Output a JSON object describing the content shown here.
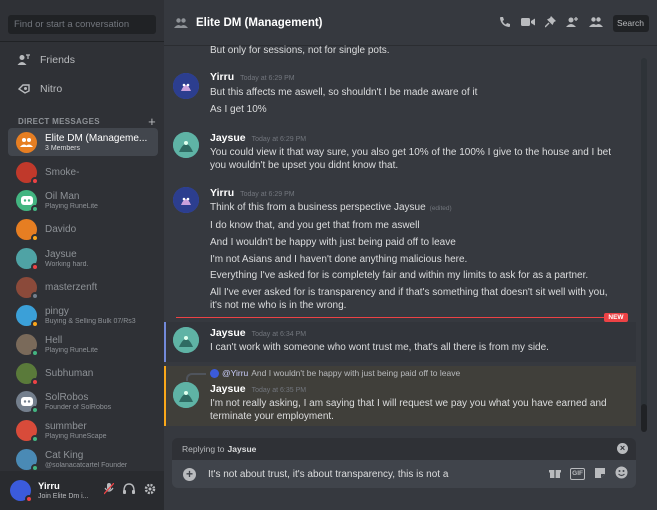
{
  "sidebar": {
    "search_placeholder": "Find or start a conversation",
    "nav": [
      {
        "label": "Friends"
      },
      {
        "label": "Nitro"
      }
    ],
    "dm_header": "DIRECT MESSAGES",
    "dms": [
      {
        "name": "Elite DM (Manageme...",
        "sub": "3 Members",
        "color": "#e67e22",
        "status": ""
      },
      {
        "name": "Smoke-",
        "sub": "",
        "color": "#c0392b",
        "status": "#ed4245"
      },
      {
        "name": "Oil Man",
        "sub": "Playing RuneLite",
        "color": "#43b581",
        "status": "#43b581"
      },
      {
        "name": "Davido",
        "sub": "",
        "color": "#e67e22",
        "status": "#faa61a"
      },
      {
        "name": "Jaysue",
        "sub": "Working hard.",
        "color": "#4fa3a5",
        "status": "#ed4245"
      },
      {
        "name": "masterzenft",
        "sub": "",
        "color": "#8b4a3a",
        "status": "#747f8d"
      },
      {
        "name": "pingy",
        "sub": "Buying & Selling Bulk 07/Rs3",
        "color": "#3ba0d8",
        "status": "#faa61a"
      },
      {
        "name": "Hell",
        "sub": "Playing RuneLite",
        "color": "#7a6a5a",
        "status": "#43b581"
      },
      {
        "name": "Subhuman",
        "sub": "",
        "color": "#5a7a3a",
        "status": "#ed4245"
      },
      {
        "name": "SolRobos",
        "sub": "Founder of SolRobos",
        "color": "#747f8d",
        "status": "#43b581"
      },
      {
        "name": "summber",
        "sub": "Playing RuneScape",
        "color": "#d84b3a",
        "status": "#43b581"
      },
      {
        "name": "Cat King",
        "sub": "@solanacatcartel Founder",
        "color": "#4a8ab5",
        "status": "#43b581"
      }
    ],
    "user": {
      "name": "Yirru",
      "sub": "Join Elite Dm i..."
    }
  },
  "header": {
    "title": "Elite DM (Management)",
    "search_label": "Search"
  },
  "messages": {
    "m0": {
      "lines": [
        "But only for sessions, not for single pots."
      ]
    },
    "m1": {
      "author": "Yirru",
      "time": "Today at 6:29 PM",
      "lines": [
        "But this affects me aswell, so shouldn't I be made aware of it",
        "As I get 10%"
      ]
    },
    "m2": {
      "author": "Jaysue",
      "time": "Today at 6:29 PM",
      "lines": [
        "You could view it that way sure, you also get 10% of the 100% I give to the house and I bet",
        "you wouldn't be upset you didnt know that."
      ]
    },
    "m3": {
      "author": "Yirru",
      "time": "Today at 6:29 PM",
      "edited": "(edited)",
      "lines": [
        "Think of this from a business perspective Jaysue",
        "I do know that, and you get that from me aswell",
        "And I wouldn't be happy with just being paid off to leave",
        "I'm not Asians and I haven't done anything malicious here.",
        "Everything I've asked for is completely fair and within my limits to ask for as a partner.",
        "All I've ever asked for is transparency and if that's something that doesn't sit well with you,",
        "it's not me who is in the wrong."
      ]
    },
    "new_label": "NEW",
    "m4": {
      "author": "Jaysue",
      "time": "Today at 6:34 PM",
      "lines": [
        "I can't work with someone who wont trust me, that's all there is from my side."
      ]
    },
    "m5": {
      "reply_mention": "@Yirru",
      "reply_text": "And I wouldn't be happy with just being paid off to leave",
      "author": "Jaysue",
      "time": "Today at 6:35 PM",
      "lines": [
        "I'm not really asking, I am saying that I will request we pay you what you have earned and",
        "terminate your employment."
      ]
    }
  },
  "composer": {
    "replying_prefix": "Replying to",
    "replying_to": "Jaysue",
    "text": "It's not about trust, it's about transparency, this is not a",
    "gif_label": "GIF"
  },
  "colors": {
    "yirru_name": "#ffffff",
    "jaysue_name": "#ffffff",
    "accent": "#7289da",
    "new_red": "#ed4245",
    "mention_bg": "#faa81a"
  }
}
